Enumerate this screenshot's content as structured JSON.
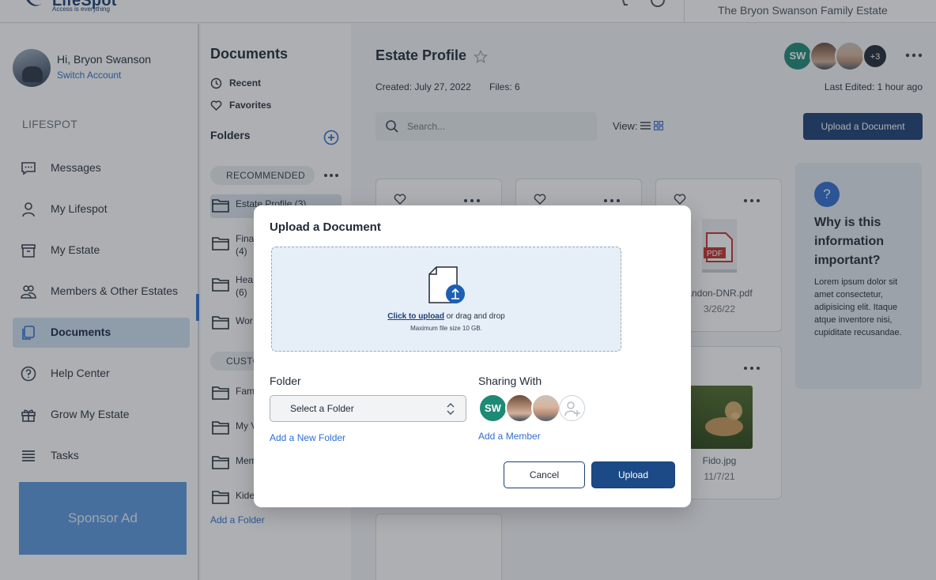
{
  "header": {
    "logo_word": "LifeSpot",
    "logo_tagline": "Access is everything",
    "estate_name": "The Bryon Swanson Family Estate"
  },
  "user": {
    "greeting": "Hi, Bryon Swanson",
    "switch_account": "Switch Account"
  },
  "sidebar": {
    "section_label": "LIFESPOT",
    "items": [
      {
        "label": "Messages",
        "icon": "chat-icon"
      },
      {
        "label": "My Lifespot",
        "icon": "person-icon"
      },
      {
        "label": "My Estate",
        "icon": "archive-box-icon"
      },
      {
        "label": "Members & Other Estates",
        "icon": "people-icon"
      },
      {
        "label": "Documents",
        "icon": "documents-icon",
        "active": true
      },
      {
        "label": "Help Center",
        "icon": "help-circle-icon"
      },
      {
        "label": "Grow My Estate",
        "icon": "gift-icon"
      },
      {
        "label": "Tasks",
        "icon": "list-icon"
      }
    ],
    "sponsor": "Sponsor Ad"
  },
  "docs_col": {
    "title": "Documents",
    "recent": "Recent",
    "favorites": "Favorites",
    "folders_title": "Folders",
    "recommended": "RECOMMENDED",
    "custom": "CUSTO",
    "folders": [
      {
        "label": "Estate Profile (3)"
      },
      {
        "label": "Fina\n(4)"
      },
      {
        "label": "Hea\n(6)"
      },
      {
        "label": "Wor"
      }
    ],
    "custom_folders": [
      {
        "label": "Fam"
      },
      {
        "label": "My V"
      },
      {
        "label": "Mem"
      },
      {
        "label": "Kide"
      }
    ],
    "add_folder": "Add a Folder"
  },
  "main": {
    "title": "Estate Profile",
    "created": "Created: July 27, 2022",
    "files": "Files: 6",
    "last_edited": "Last Edited: 1 hour ago",
    "avatar_initials": "SW",
    "avatar_more": "+3",
    "search_placeholder": "Search...",
    "view_label": "View:",
    "upload_button": "Upload a Document",
    "cards": [
      {
        "name": "andon-DNR.pdf",
        "date": "3/26/22",
        "badge": "PDF"
      },
      {
        "name": "Fido.jpg",
        "date": "11/7/21"
      }
    ]
  },
  "info": {
    "q": "?",
    "title": "Why is this information important?",
    "body": "Lorem ipsum dolor sit amet consectetur, adipisicing elit. Itaque atque inventore nisi, cupiditate recusandae."
  },
  "modal": {
    "title": "Upload a Document",
    "click_upload": "Click to upload",
    "drag_drop": " or drag and drop",
    "max_size": "Maximum file size 10 GB.",
    "folder_label": "Folder",
    "select_value": "Select a Folder",
    "add_folder": "Add a New Folder",
    "sharing_label": "Sharing With",
    "share_initials": "SW",
    "add_member": "Add a Member",
    "cancel": "Cancel",
    "upload": "Upload"
  },
  "colors": {
    "brand": "#1c3f74",
    "accent": "#2f6fd1",
    "avatar_green": "#1e8a75",
    "sidebar_active": "#cfe0f3",
    "sponsor": "#5a98df"
  }
}
